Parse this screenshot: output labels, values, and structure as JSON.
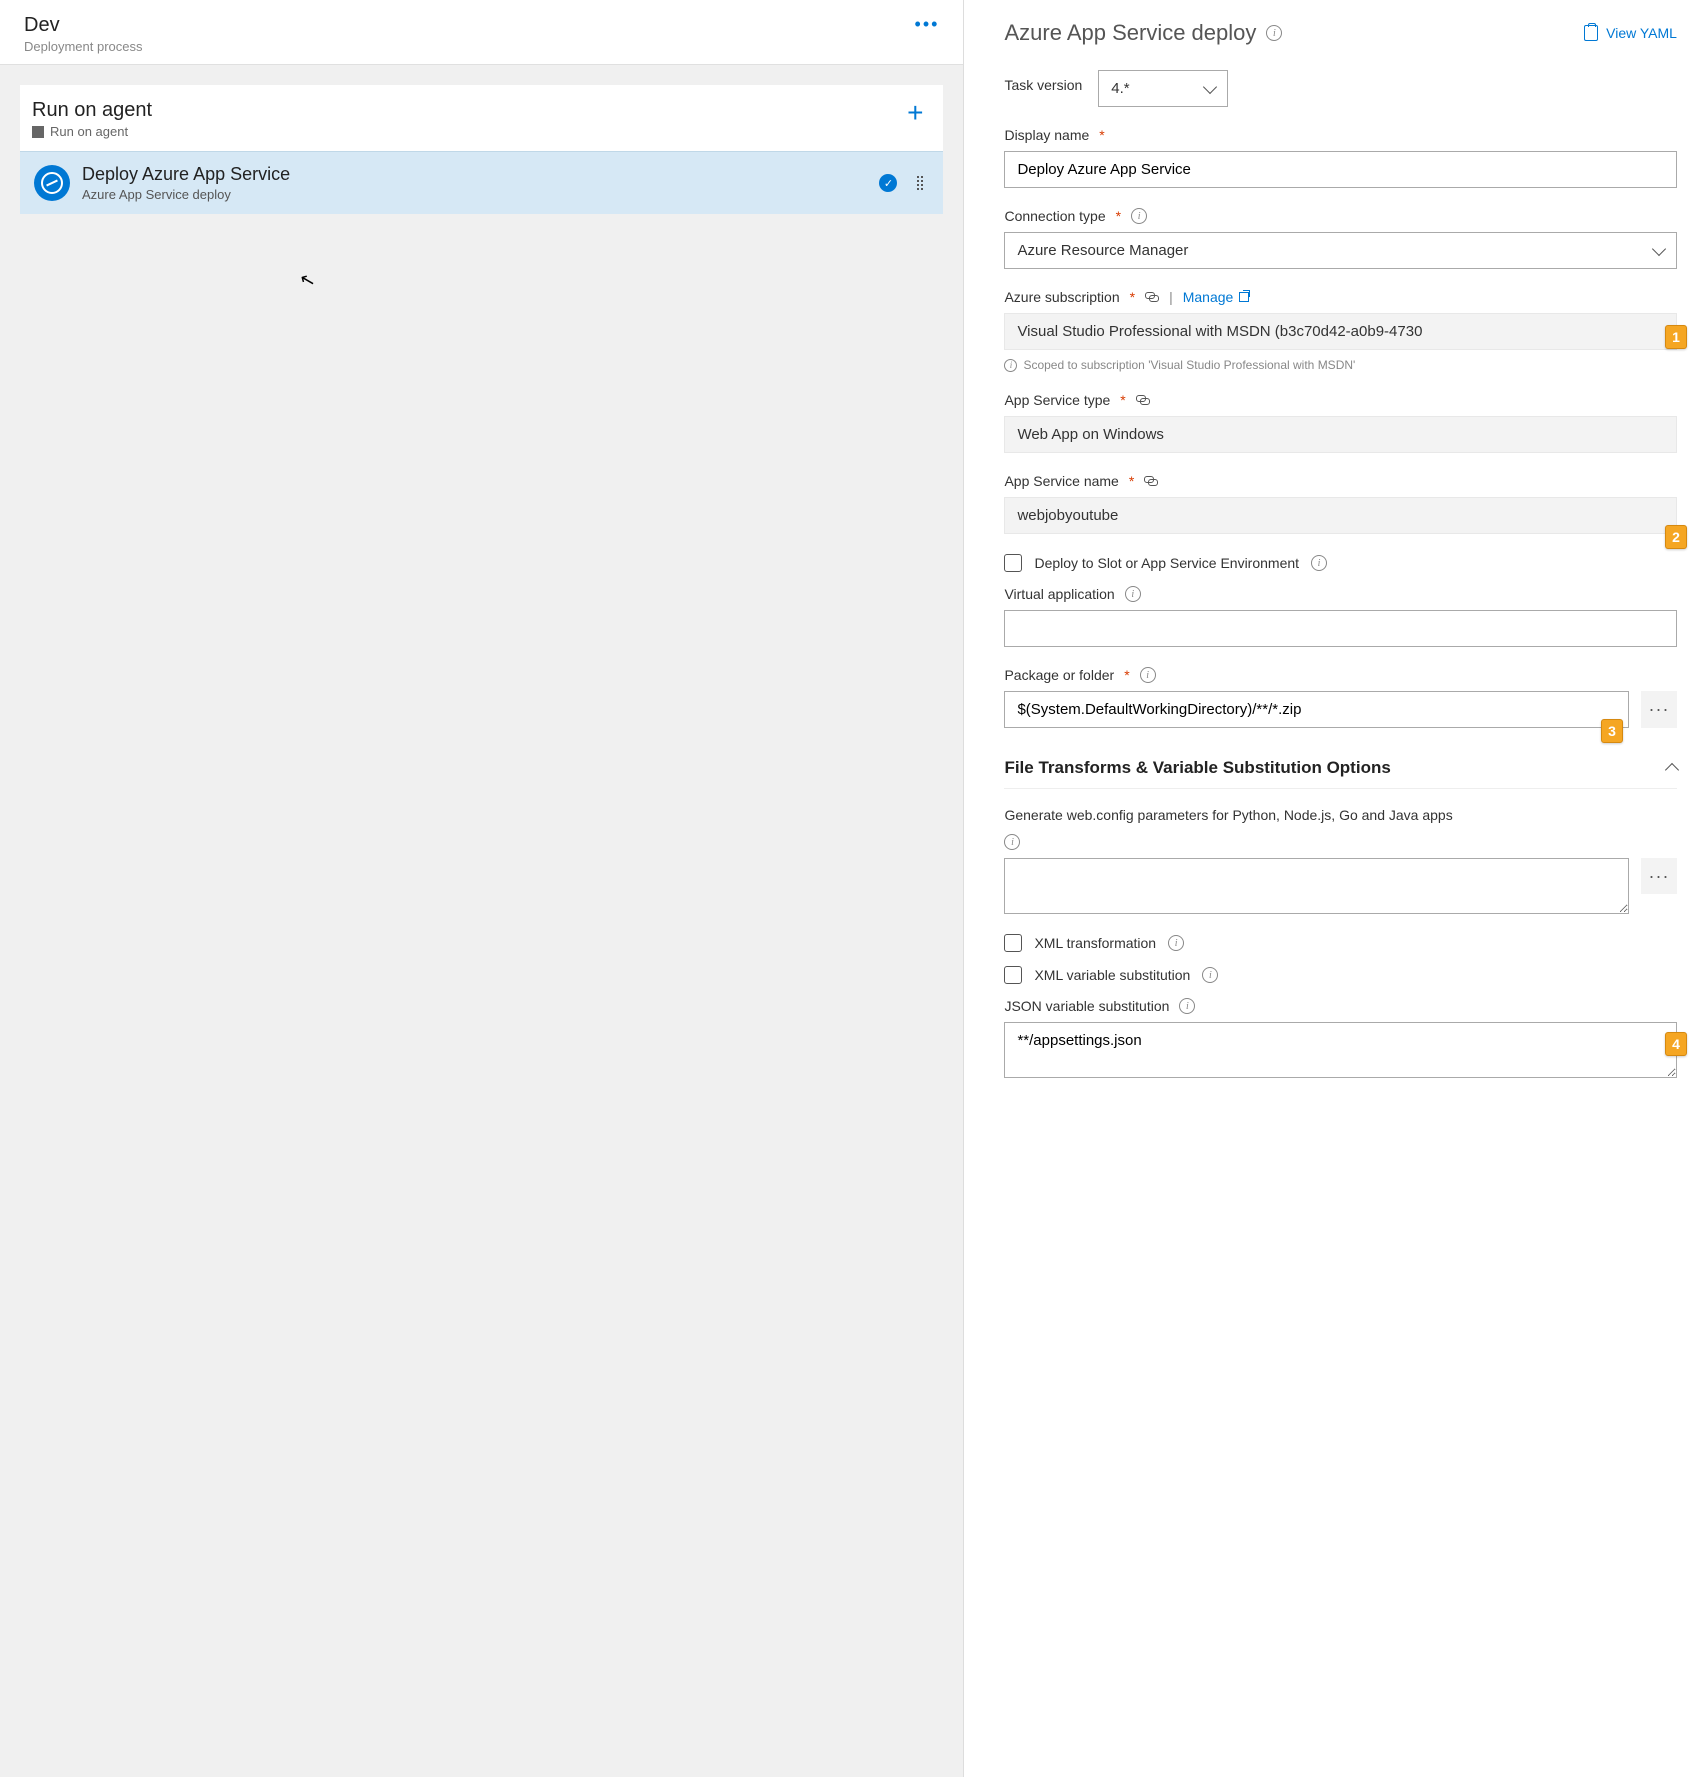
{
  "left": {
    "title": "Dev",
    "subtitle": "Deployment process",
    "group": {
      "title": "Run on agent",
      "subtitle": "Run on agent"
    },
    "task": {
      "title": "Deploy Azure App Service",
      "subtitle": "Azure App Service deploy"
    }
  },
  "right": {
    "title": "Azure App Service deploy",
    "view_yaml": "View YAML",
    "task_version_label": "Task version",
    "task_version_value": "4.*",
    "display_name_label": "Display name",
    "display_name_value": "Deploy Azure App Service",
    "connection_type_label": "Connection type",
    "connection_type_value": "Azure Resource Manager",
    "azure_sub_label": "Azure subscription",
    "manage_label": "Manage",
    "azure_sub_value": "Visual Studio Professional with MSDN (b3c70d42-a0b9-4730",
    "scoped_note": "Scoped to subscription 'Visual Studio Professional with MSDN'",
    "app_service_type_label": "App Service type",
    "app_service_type_value": "Web App on Windows",
    "app_service_name_label": "App Service name",
    "app_service_name_value": "webjobyoutube",
    "deploy_slot_label": "Deploy to Slot or App Service Environment",
    "virtual_app_label": "Virtual application",
    "virtual_app_value": "",
    "package_label": "Package or folder",
    "package_value": "$(System.DefaultWorkingDirectory)/**/*.zip",
    "section_title": "File Transforms & Variable Substitution Options",
    "webconfig_label": "Generate web.config parameters for Python, Node.js, Go and Java apps",
    "webconfig_value": "",
    "xml_transform_label": "XML transformation",
    "xml_varsub_label": "XML variable substitution",
    "json_varsub_label": "JSON variable substitution",
    "json_varsub_value": "**/appsettings.json"
  },
  "badges": {
    "b1": "1",
    "b2": "2",
    "b3": "3",
    "b4": "4"
  }
}
